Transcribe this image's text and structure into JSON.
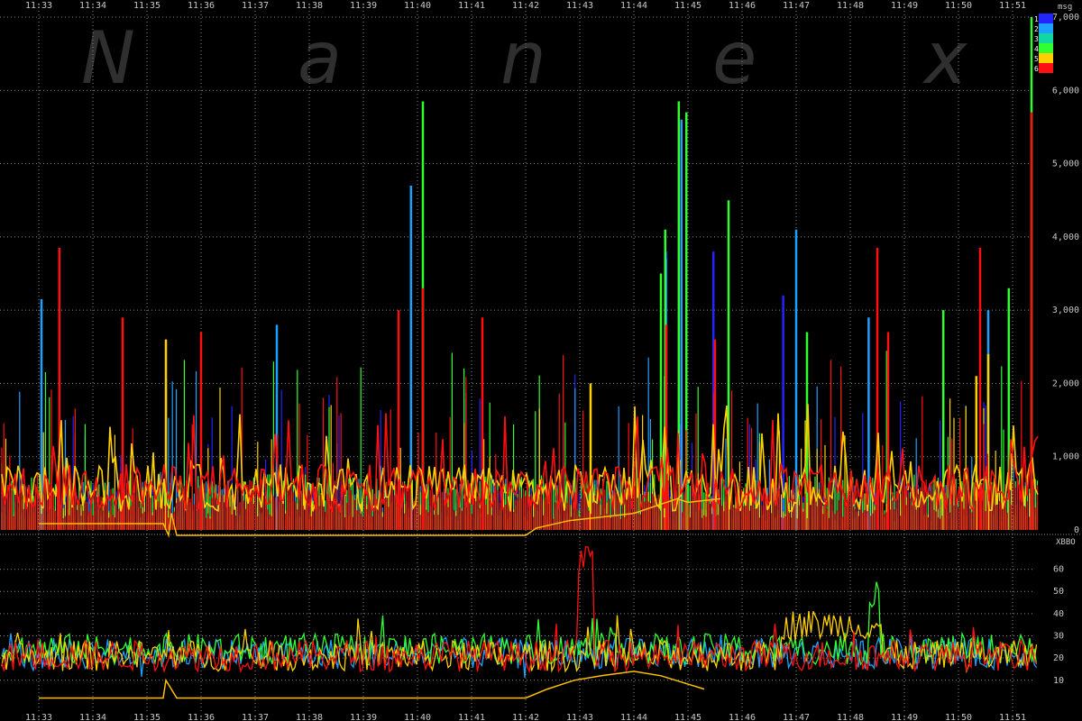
{
  "watermark": [
    "N",
    "a",
    "n",
    "e",
    "x"
  ],
  "colors": {
    "background": "#000000",
    "grid": "#8a8a8a",
    "text": "#c8c8c8",
    "watermark": "#2f2f2f"
  },
  "chart_data": [
    {
      "type": "area",
      "panel": "top",
      "unit_label": "msg",
      "x_ticks": [
        "11:33",
        "11:34",
        "11:35",
        "11:36",
        "11:37",
        "11:38",
        "11:39",
        "11:40",
        "11:41",
        "11:42",
        "11:43",
        "11:44",
        "11:45",
        "11:46",
        "11:47",
        "11:48",
        "11:49",
        "11:50",
        "11:51"
      ],
      "y_ticks": [
        0,
        1000,
        2000,
        3000,
        4000,
        5000,
        6000,
        7000
      ],
      "y_tick_labels": [
        "0",
        "1,000",
        "2,000",
        "3,000",
        "4,000",
        "5,000",
        "6,000",
        "7,000"
      ],
      "ylim": [
        0,
        7000
      ],
      "grid": true,
      "legend": {
        "placement": "top-right",
        "entries": [
          {
            "label": "1",
            "color": "#2424ff"
          },
          {
            "label": "2",
            "color": "#1ea0ff"
          },
          {
            "label": "3",
            "color": "#10d8a0"
          },
          {
            "label": "4",
            "color": "#30ff30"
          },
          {
            "label": "5",
            "color": "#ffd000"
          },
          {
            "label": "6",
            "color": "#ff1010"
          }
        ]
      },
      "series": [
        {
          "color": "#2424ff",
          "typical": 450,
          "spikes": [
            [
              11.6,
              3800
            ],
            [
              12.47,
              3800
            ],
            [
              13.76,
              3200
            ]
          ]
        },
        {
          "color": "#1ea0ff",
          "typical": 500,
          "spikes": [
            [
              0.05,
              3150
            ],
            [
              4.4,
              2800
            ],
            [
              6.88,
              4700
            ],
            [
              11.59,
              3700
            ],
            [
              11.88,
              5600
            ],
            [
              14.0,
              4100
            ],
            [
              15.34,
              2900
            ],
            [
              17.55,
              3000
            ]
          ]
        },
        {
          "color": "#30ff30",
          "typical": 550,
          "spikes": [
            [
              7.1,
              5850
            ],
            [
              11.5,
              3500
            ],
            [
              11.58,
              4100
            ],
            [
              11.83,
              5850
            ],
            [
              11.97,
              5700
            ],
            [
              12.75,
              4500
            ],
            [
              14.2,
              2700
            ],
            [
              16.72,
              3000
            ],
            [
              17.93,
              3300
            ],
            [
              18.35,
              7000
            ]
          ]
        },
        {
          "color": "#ffd000",
          "typical": 400,
          "spikes": [
            [
              2.35,
              2600
            ],
            [
              10.2,
              2000
            ],
            [
              17.33,
              2100
            ],
            [
              17.55,
              2400
            ]
          ]
        },
        {
          "color": "#ff1010",
          "typical": 500,
          "spikes": [
            [
              0.38,
              3850
            ],
            [
              1.55,
              2900
            ],
            [
              3.0,
              2700
            ],
            [
              6.65,
              3000
            ],
            [
              7.1,
              3300
            ],
            [
              8.2,
              2900
            ],
            [
              11.6,
              2800
            ],
            [
              12.5,
              2600
            ],
            [
              15.5,
              3850
            ],
            [
              17.4,
              3850
            ],
            [
              18.35,
              5700
            ],
            [
              15.7,
              2700
            ]
          ]
        }
      ],
      "baseline_series": {
        "color": "#ffc000",
        "points": [
          [
            0,
            160
          ],
          [
            2.3,
            160
          ],
          [
            2.4,
            0
          ],
          [
            2.45,
            300
          ],
          [
            2.55,
            0
          ],
          [
            9.0,
            0
          ],
          [
            9.2,
            100
          ],
          [
            9.8,
            200
          ],
          [
            10.4,
            250
          ],
          [
            11.0,
            300
          ],
          [
            11.8,
            500
          ],
          [
            12.0,
            450
          ],
          [
            12.6,
            500
          ]
        ]
      }
    },
    {
      "type": "line",
      "panel": "bottom",
      "unit_label": "XBBO",
      "x_ticks": [
        "11:33",
        "11:34",
        "11:35",
        "11:36",
        "11:37",
        "11:38",
        "11:39",
        "11:40",
        "11:41",
        "11:42",
        "11:43",
        "11:44",
        "11:45",
        "11:46",
        "11:47",
        "11:48",
        "11:49",
        "11:50",
        "11:51"
      ],
      "y_ticks": [
        10,
        20,
        30,
        40,
        50,
        60
      ],
      "y_tick_labels": [
        "10",
        "20",
        "30",
        "40",
        "50",
        "60"
      ],
      "ylim": [
        3,
        72
      ],
      "grid": true,
      "series": [
        {
          "color": "#1ea0ff",
          "level": 22
        },
        {
          "color": "#30ff30",
          "level": 24
        },
        {
          "color": "#ffd000",
          "level": 21
        },
        {
          "color": "#ff1010",
          "level": 21
        }
      ],
      "events": [
        {
          "color": "#ff1010",
          "from": 9.95,
          "to": 10.25,
          "value": 66
        },
        {
          "color": "#ffd000",
          "from": 13.7,
          "to": 15.6,
          "value": 35
        },
        {
          "color": "#30ff30",
          "from": 15.35,
          "to": 15.55,
          "value": 44
        }
      ],
      "baseline_series": {
        "color": "#ffc000",
        "points": [
          [
            0,
            2
          ],
          [
            2.3,
            2
          ],
          [
            2.35,
            10
          ],
          [
            2.45,
            6
          ],
          [
            2.55,
            2
          ],
          [
            9.0,
            2
          ],
          [
            9.4,
            6
          ],
          [
            9.9,
            10
          ],
          [
            10.4,
            12
          ],
          [
            11.0,
            14
          ],
          [
            11.5,
            12
          ],
          [
            11.9,
            9
          ],
          [
            12.3,
            6
          ]
        ]
      }
    }
  ]
}
